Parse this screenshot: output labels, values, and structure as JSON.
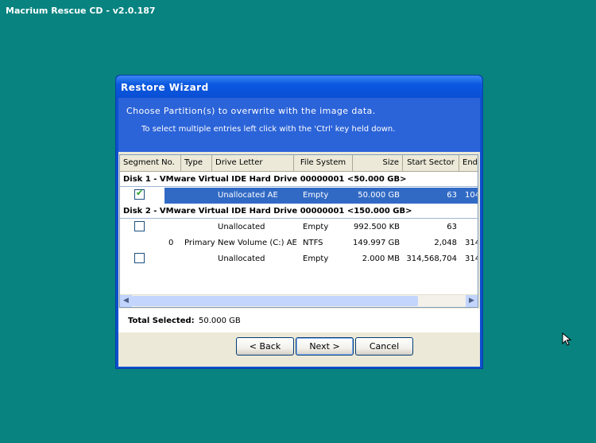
{
  "app": {
    "title": "Macrium Rescue CD - v2.0.187"
  },
  "dialog": {
    "title": "Restore Wizard",
    "heading": "Choose  Partition(s)  to overwrite with the image data.",
    "subheading": "To select multiple entries left click with the 'Ctrl' key held down."
  },
  "table": {
    "columns": [
      "Segment No.",
      "Type",
      "Drive Letter",
      "File System",
      "Size",
      "Start Sector",
      "End"
    ],
    "disks": [
      {
        "header": "Disk 1 - VMware Virtual IDE Hard Drive 00000001  <50.000 GB>",
        "rows": [
          {
            "checked": true,
            "selected": true,
            "segment": "",
            "type": "",
            "drive": "Unallocated  AE",
            "fs": "Empty",
            "size": "50.000 GB",
            "start": "63",
            "end": "104"
          }
        ]
      },
      {
        "header": "Disk 2 - VMware Virtual IDE Hard Drive 00000001  <150.000 GB>",
        "rows": [
          {
            "checkbox": true,
            "checked": false,
            "segment": "",
            "type": "",
            "drive": "Unallocated",
            "fs": "Empty",
            "size": "992.500 KB",
            "start": "63",
            "end": ""
          },
          {
            "checkbox": false,
            "segment": "0",
            "type": "Primary",
            "drive": "New Volume (C:)  AE",
            "fs": "NTFS",
            "size": "149.997 GB",
            "start": "2,048",
            "end": "314"
          },
          {
            "checkbox": true,
            "checked": false,
            "segment": "",
            "type": "",
            "drive": "Unallocated",
            "fs": "Empty",
            "size": "2.000 MB",
            "start": "314,568,704",
            "end": "314"
          }
        ]
      }
    ]
  },
  "totals": {
    "label": "Total Selected:",
    "value": "50.000 GB"
  },
  "buttons": {
    "back": "< Back",
    "next": "Next >",
    "cancel": "Cancel"
  },
  "icons": {
    "scroll_left": "left-arrow-icon",
    "scroll_right": "right-arrow-icon",
    "cursor": "mouse-pointer-icon"
  },
  "colors": {
    "desktop": "#088380",
    "title_bar": "#0b58e0",
    "header_band": "#2b63d8",
    "selection": "#316ac5"
  }
}
